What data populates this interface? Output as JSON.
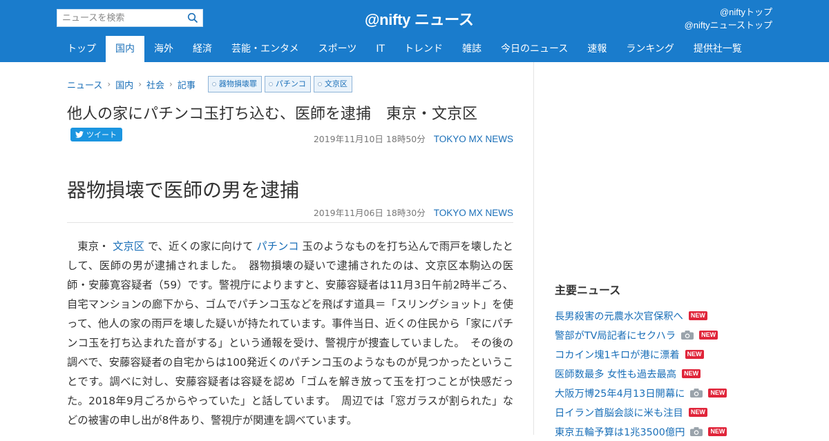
{
  "header": {
    "search_placeholder": "ニュースを検索",
    "logo": "@nifty ニュース",
    "links": [
      "@niftyトップ",
      "@niftyニューストップ"
    ]
  },
  "nav": [
    "トップ",
    "国内",
    "海外",
    "経済",
    "芸能・エンタメ",
    "スポーツ",
    "IT",
    "トレンド",
    "雑誌",
    "今日のニュース",
    "速報",
    "ランキング",
    "提供社一覧"
  ],
  "nav_active_index": 1,
  "breadcrumb": [
    "ニュース",
    "国内",
    "社会",
    "記事"
  ],
  "tags": [
    "器物損壊罪",
    "パチンコ",
    "文京区"
  ],
  "article": {
    "title": "他人の家にパチンコ玉打ち込む、医師を逮捕　東京・文京区",
    "tweet_label": "ツイート",
    "date1": "2019年11月10日 18時50分",
    "source1": "TOKYO MX NEWS",
    "headline": "器物損壊で医師の男を逮捕",
    "date2": "2019年11月06日 18時30分",
    "source2": "TOKYO MX NEWS",
    "body_pre": "　東京・",
    "link1": "文京区",
    "body_mid": "で、近くの家に向けて",
    "link2": "パチンコ",
    "body_post": "玉のようなものを打ち込んで雨戸を壊したとして、医師の男が逮捕されました。　器物損壊の疑いで逮捕されたのは、文京区本駒込の医師・安藤寛容疑者（59）です。警視庁によりますと、安藤容疑者は11月3日午前2時半ごろ、自宅マンションの廊下から、ゴムでパチンコ玉などを飛ばす道具＝「スリングショット」を使って、他人の家の雨戸を壊した疑いが持たれています。事件当日、近くの住民から「家にパチンコ玉を打ち込まれた音がする」という通報を受け、警視庁が捜査していました。　その後の調べで、安藤容疑者の自宅からは100発近くのパチンコ玉のようなものが見つかったということです。調べに対し、安藤容疑者は容疑を認め「ゴムを解き放って玉を打つことが快感だった。2018年9月ごろからやっていた」と話しています。　周辺では「窓ガラスが割られた」などの被害の申し出が8件あり、警視庁が関連を調べています。"
  },
  "sidebar": {
    "title": "主要ニュース",
    "new_label": "NEW",
    "items": [
      {
        "text": "長男殺害の元農水次官保釈へ",
        "camera": false
      },
      {
        "text": "警部がTV局記者にセクハラ",
        "camera": true
      },
      {
        "text": "コカイン塊1キロが港に漂着",
        "camera": false
      },
      {
        "text": "医師数最多 女性も過去最高",
        "camera": false
      },
      {
        "text": "大阪万博25年4月13日開幕に",
        "camera": true
      },
      {
        "text": "日イラン首脳会談に米も注目",
        "camera": false
      },
      {
        "text": "東京五輪予算は1兆3500億円",
        "camera": true
      }
    ]
  },
  "colors": {
    "header_bg": "#1a7ccc",
    "link": "#1a6fb8",
    "new_badge": "#e0253a",
    "tweet": "#1b95e0"
  }
}
